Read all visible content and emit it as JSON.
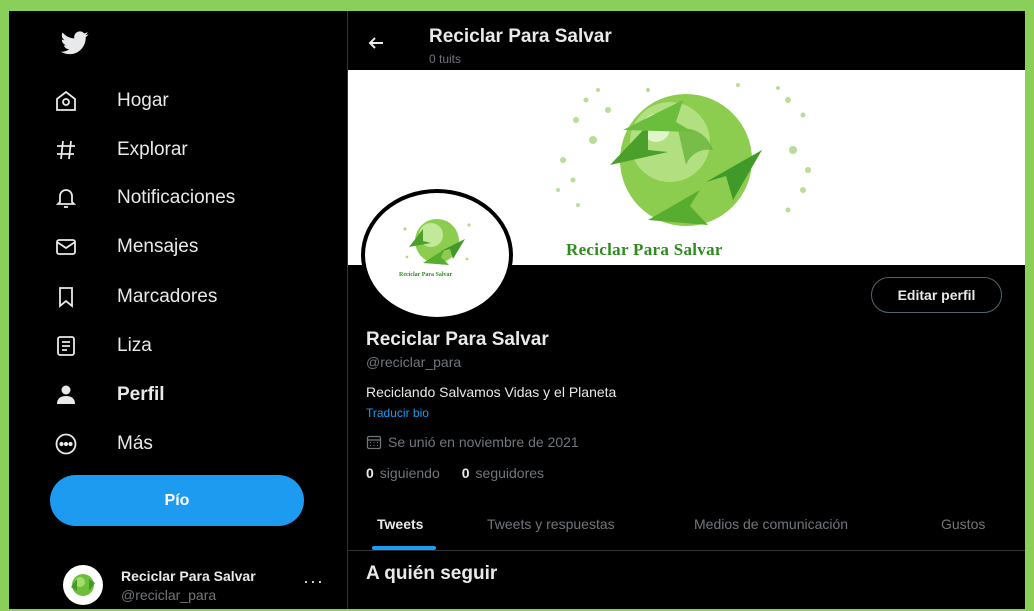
{
  "sidebar": {
    "logo": "twitter-bird-icon",
    "items": [
      {
        "label": "Hogar",
        "icon": "home-icon"
      },
      {
        "label": "Explorar",
        "icon": "hashtag-icon"
      },
      {
        "label": "Notificaciones",
        "icon": "bell-icon"
      },
      {
        "label": "Mensajes",
        "icon": "envelope-icon"
      },
      {
        "label": "Marcadores",
        "icon": "bookmark-icon"
      },
      {
        "label": "Liza",
        "icon": "list-icon"
      },
      {
        "label": "Perfil",
        "icon": "person-icon",
        "active": true
      },
      {
        "label": "Más",
        "icon": "more-circle-icon"
      }
    ],
    "tweet_button": "Pío",
    "account": {
      "name": "Reciclar Para Salvar",
      "handle": "@reciclar_para",
      "more": "···"
    }
  },
  "header": {
    "title": "Reciclar Para Salvar",
    "subtitle": "0 tuits"
  },
  "banner": {
    "text": "Reciclar Para Salvar"
  },
  "avatar": {
    "text": "Reciclar Para Salvar"
  },
  "profile": {
    "edit_button": "Editar perfil",
    "name": "Reciclar Para Salvar",
    "handle": "@reciclar_para",
    "bio": "Reciclando Salvamos Vidas y el Planeta",
    "translate": "Traducir bio",
    "joined": "Se unió en noviembre de 2021",
    "following_count": "0",
    "following_label": "siguiendo",
    "followers_count": "0",
    "followers_label": "seguidores"
  },
  "tabs": [
    {
      "label": "Tweets",
      "active": true
    },
    {
      "label": "Tweets y respuestas"
    },
    {
      "label": "Medios de comunicación"
    },
    {
      "label": "Gustos"
    }
  ],
  "who_to_follow": "A quién seguir",
  "colors": {
    "accent": "#1d9bf0",
    "frame_border": "#8bcf5b",
    "background": "#000000",
    "recycle_green": "#2e8b1e"
  }
}
